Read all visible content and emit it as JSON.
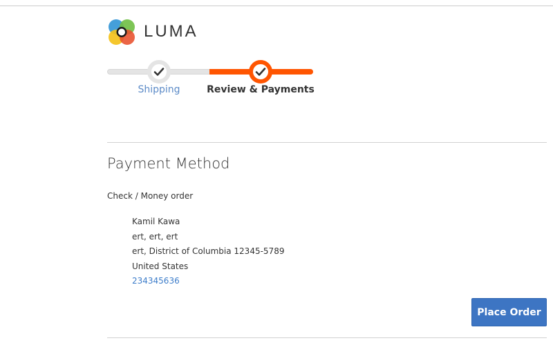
{
  "brand": {
    "name": "LUMA",
    "logo_icon": "luma-logo-icon",
    "logo_colors": [
      "#f4c21b",
      "#3b9ad8",
      "#6fbf44",
      "#e8502c"
    ]
  },
  "progress": {
    "accent_color": "#ff5501",
    "steps": [
      {
        "label": "Shipping",
        "state": "complete",
        "icon": "checkmark-icon"
      },
      {
        "label": "Review & Payments",
        "state": "active",
        "icon": "checkmark-icon"
      }
    ]
  },
  "payment": {
    "title": "Payment Method",
    "method_label": "Check / Money order",
    "billing_address": {
      "name": "Kamil Kawa",
      "street": "ert, ert, ert",
      "city_region_zip": "ert, District of Columbia 12345-5789",
      "country": "United States",
      "phone": "234345636"
    }
  },
  "actions": {
    "place_order_label": "Place Order",
    "place_order_color": "#3d75c3"
  }
}
